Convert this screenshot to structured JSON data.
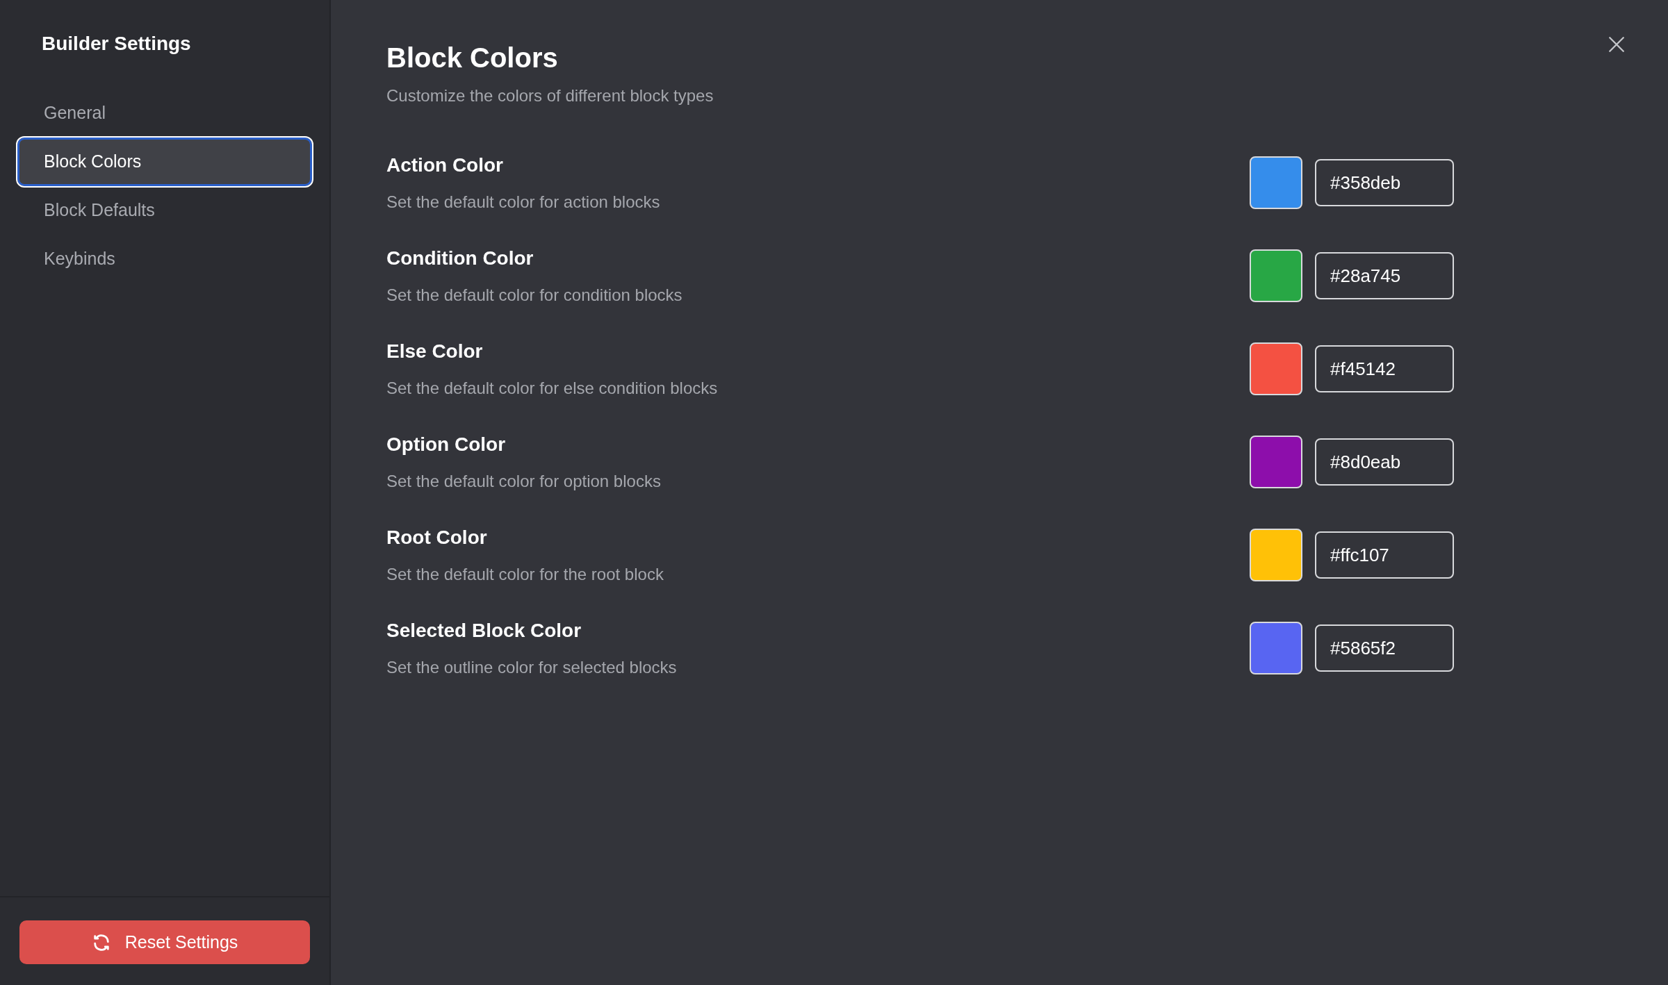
{
  "sidebar": {
    "title": "Builder Settings",
    "items": [
      {
        "label": "General",
        "selected": false
      },
      {
        "label": "Block Colors",
        "selected": true
      },
      {
        "label": "Block Defaults",
        "selected": false
      },
      {
        "label": "Keybinds",
        "selected": false
      }
    ],
    "reset_button": "Reset Settings"
  },
  "main": {
    "title": "Block Colors",
    "subtitle": "Customize the colors of different block types",
    "settings": [
      {
        "label": "Action Color",
        "description": "Set the default color for action blocks",
        "value": "#358deb",
        "color": "#358deb"
      },
      {
        "label": "Condition Color",
        "description": "Set the default color for condition blocks",
        "value": "#28a745",
        "color": "#28a745"
      },
      {
        "label": "Else Color",
        "description": "Set the default color for else condition blocks",
        "value": "#f45142",
        "color": "#f45142"
      },
      {
        "label": "Option Color",
        "description": "Set the default color for option blocks",
        "value": "#8d0eab",
        "color": "#8d0eab"
      },
      {
        "label": "Root Color",
        "description": "Set the default color for the root block",
        "value": "#ffc107",
        "color": "#ffc107"
      },
      {
        "label": "Selected Block Color",
        "description": "Set the outline color for selected blocks",
        "value": "#5865f2",
        "color": "#5865f2"
      }
    ]
  }
}
